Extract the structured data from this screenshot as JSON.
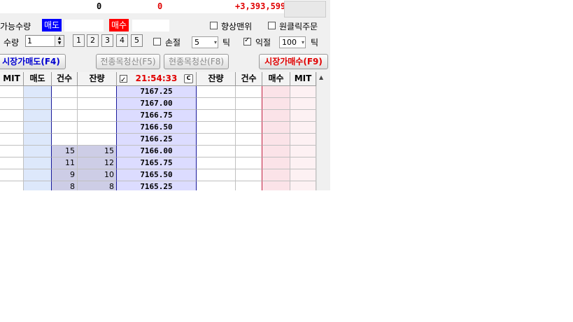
{
  "top_bar": {
    "value_a": "0",
    "value_b": "0",
    "pnl": "+3,393,599"
  },
  "labels": {
    "available_qty": "가능수량",
    "sell_tag": "매도",
    "buy_tag": "매수",
    "favorable_exit": "향상맨위",
    "one_click": "원클릭주문",
    "qty": "수량",
    "stop_loss": "손절",
    "take_profit": "익절",
    "tick_1": "틱",
    "tick_2": "틱"
  },
  "inputs": {
    "qty_value": "1",
    "stop_loss_ticks": "5",
    "take_profit_ticks": "100"
  },
  "checkboxes": {
    "favorable_exit": false,
    "one_click": false,
    "stop_loss": false,
    "take_profit": true,
    "header": true
  },
  "qty_buttons": [
    "1",
    "2",
    "3",
    "4",
    "5"
  ],
  "buttons": {
    "market_sell": "시장가매도(F4)",
    "liquidate_all": "전종목청산(F5)",
    "liquidate_current": "현종목청산(F8)",
    "market_buy": "시장가매수(F9)"
  },
  "table": {
    "headers": [
      "MIT",
      "매도",
      "건수",
      "잔량",
      "21:54:33",
      "잔량",
      "건수",
      "매수",
      "MIT"
    ],
    "clock_button": "C",
    "rows": [
      {
        "sell_count": "",
        "sell_qty": "",
        "price": "7167.25"
      },
      {
        "sell_count": "",
        "sell_qty": "",
        "price": "7167.00"
      },
      {
        "sell_count": "",
        "sell_qty": "",
        "price": "7166.75"
      },
      {
        "sell_count": "",
        "sell_qty": "",
        "price": "7166.50"
      },
      {
        "sell_count": "",
        "sell_qty": "",
        "price": "7166.25"
      },
      {
        "sell_count": "15",
        "sell_qty": "15",
        "price": "7166.00"
      },
      {
        "sell_count": "11",
        "sell_qty": "12",
        "price": "7165.75"
      },
      {
        "sell_count": "9",
        "sell_qty": "10",
        "price": "7165.50"
      },
      {
        "sell_count": "8",
        "sell_qty": "8",
        "price": "7165.25"
      }
    ]
  },
  "colors": {
    "sell": "#0000ff",
    "buy": "#ff0000",
    "time": "#e00000",
    "price_col": "#dcdcff",
    "sell_col": "#dde8fb",
    "buy_col": "#fbe3e8",
    "pnl": "#e00000"
  }
}
